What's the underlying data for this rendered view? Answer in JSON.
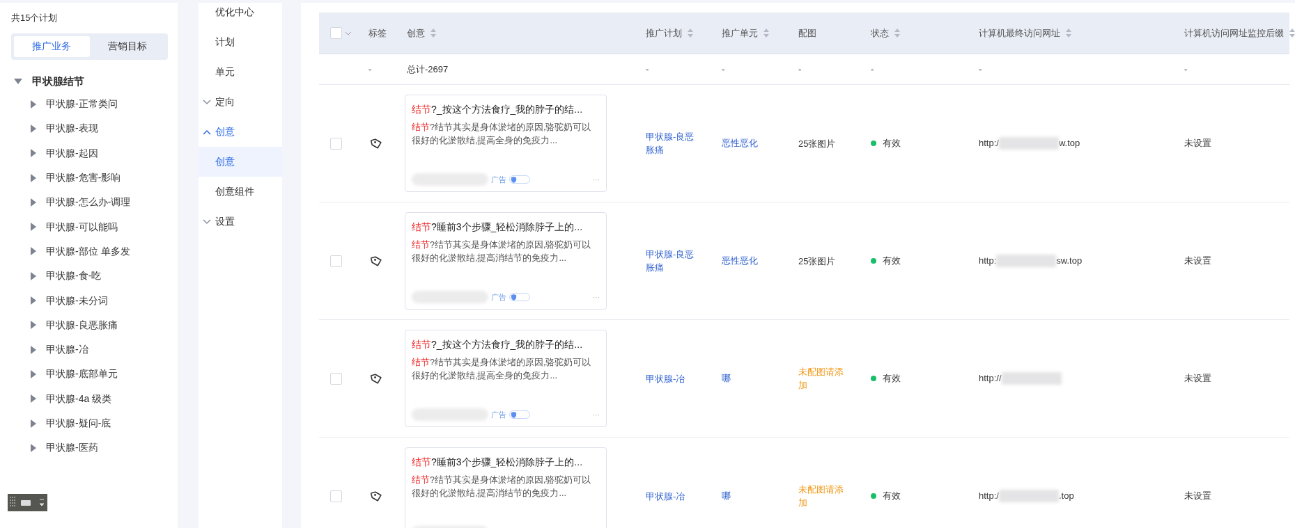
{
  "plans_panel": {
    "count_label": "共15个计划",
    "tabs": [
      {
        "label": "推广业务",
        "selected": true
      },
      {
        "label": "营销目标",
        "selected": false
      }
    ],
    "tree": {
      "label": "甲状腺结节",
      "expanded": true,
      "children": [
        {
          "label": "甲状腺-正常类问",
          "expanded": false
        },
        {
          "label": "甲状腺-表现",
          "expanded": false
        },
        {
          "label": "甲状腺-起因",
          "expanded": false
        },
        {
          "label": "甲状腺-危害-影响",
          "expanded": false
        },
        {
          "label": "甲状腺-怎么办-调理",
          "expanded": false
        },
        {
          "label": "甲状腺-可以能吗",
          "expanded": false
        },
        {
          "label": "甲状腺-部位 单多发",
          "expanded": false
        },
        {
          "label": "甲状腺-食-吃",
          "expanded": false
        },
        {
          "label": "甲状腺-未分词",
          "expanded": false
        },
        {
          "label": "甲状腺-良恶胀痛",
          "expanded": false
        },
        {
          "label": "甲状腺-冶",
          "expanded": false
        },
        {
          "label": "甲状腺-底部单元",
          "expanded": false
        },
        {
          "label": "甲状腺-4a 级类",
          "expanded": false
        },
        {
          "label": "甲状腺-疑问-底",
          "expanded": false
        },
        {
          "label": "甲状腺-医药",
          "expanded": false
        }
      ]
    }
  },
  "nav": [
    {
      "kind": "item",
      "label": "优化中心",
      "selected": false
    },
    {
      "kind": "item",
      "label": "计划",
      "selected": false
    },
    {
      "kind": "item",
      "label": "单元",
      "selected": false
    },
    {
      "kind": "group",
      "label": "定向",
      "expanded": false
    },
    {
      "kind": "group",
      "label": "创意",
      "expanded": true,
      "children": [
        {
          "label": "创意",
          "selected": true
        },
        {
          "label": "创意组件",
          "selected": false
        }
      ]
    },
    {
      "kind": "group",
      "label": "设置",
      "expanded": false
    }
  ],
  "table": {
    "select_all": false,
    "columns": [
      {
        "label": "标签",
        "sortable": false
      },
      {
        "label": "创意",
        "sortable": true
      },
      {
        "label": "推广计划",
        "sortable": true
      },
      {
        "label": "推广单元",
        "sortable": true
      },
      {
        "label": "配图",
        "sortable": false
      },
      {
        "label": "状态",
        "sortable": true
      },
      {
        "label": "计算机最终访问网址",
        "sortable": true
      },
      {
        "label": "计算机访问网址监控后缀",
        "sortable": true
      }
    ],
    "total_row": {
      "tag": "-",
      "creative": "总计-2697",
      "plan": "-",
      "unit": "-",
      "images": "-",
      "status": "-",
      "url": "-",
      "suffix": "-"
    },
    "rows": [
      {
        "checked": false,
        "title_keyword": "结节",
        "title_rest": "?_按这个方法食疗_我的脖子的结...",
        "desc_keyword": "结节",
        "desc_rest": "?结节其实是身体淤堵的原因,骆驼奶可以很好的化淤散结,提高全身的免疫力...",
        "ad_label": "广告",
        "more": "···",
        "plan": "甲状腺-良恶胀痛",
        "unit": "恶性恶化",
        "images": {
          "text": "25张图片",
          "missing": false
        },
        "status": {
          "label": "有效",
          "color": "#19be6b"
        },
        "url_prefix": "http:/",
        "url_suffix": "w.top",
        "suffix": "未设置"
      },
      {
        "checked": false,
        "title_keyword": "结节",
        "title_rest": "?睡前3个步骤_轻松消除脖子上的...",
        "desc_keyword": "结节",
        "desc_rest": "?结节其实是身体淤堵的原因,骆驼奶可以很好的化淤散结,提高消结节的免疫力...",
        "ad_label": "广告",
        "more": "···",
        "plan": "甲状腺-良恶胀痛",
        "unit": "恶性恶化",
        "images": {
          "text": "25张图片",
          "missing": false
        },
        "status": {
          "label": "有效",
          "color": "#19be6b"
        },
        "url_prefix": "http:",
        "url_suffix": "sw.top",
        "suffix": "未设置"
      },
      {
        "checked": false,
        "title_keyword": "结节",
        "title_rest": "?_按这个方法食疗_我的脖子的结...",
        "desc_keyword": "结节",
        "desc_rest": "?结节其实是身体淤堵的原因,骆驼奶可以很好的化淤散结,提高全身的免疫力...",
        "ad_label": "广告",
        "more": "···",
        "plan": "甲状腺-冶",
        "unit": "哪",
        "images": {
          "text": "未配图请添加",
          "missing": true
        },
        "status": {
          "label": "有效",
          "color": "#19be6b"
        },
        "url_prefix": "http://",
        "url_suffix": "",
        "suffix": "未设置"
      },
      {
        "checked": false,
        "title_keyword": "结节",
        "title_rest": "?睡前3个步骤_轻松消除脖子上的...",
        "desc_keyword": "结节",
        "desc_rest": "?结节其实是身体淤堵的原因,骆驼奶可以很好的化淤散结,提高消结节的免疫力...",
        "plan": "甲状腺-冶",
        "unit": "哪",
        "images": {
          "text": "未配图请添加",
          "missing": true
        },
        "status": {
          "label": "有效",
          "color": "#19be6b"
        },
        "url_prefix": "http:/",
        "url_suffix": ".top",
        "suffix": "未设置"
      }
    ]
  }
}
